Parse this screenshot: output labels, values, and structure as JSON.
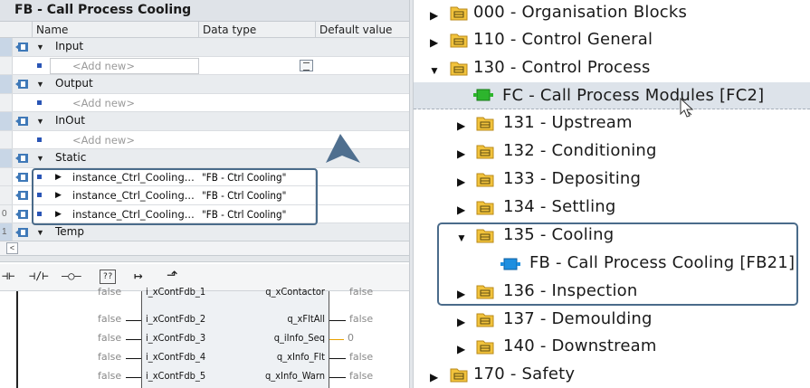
{
  "left": {
    "title": "FB - Call Process Cooling",
    "columns": {
      "name": "Name",
      "datatype": "Data type",
      "default": "Default value"
    },
    "rows": [
      {
        "kind": "section",
        "label": "Input"
      },
      {
        "kind": "addnew",
        "label": "<Add new>"
      },
      {
        "kind": "section",
        "label": "Output"
      },
      {
        "kind": "addnew",
        "label": "<Add new>"
      },
      {
        "kind": "section",
        "label": "InOut"
      },
      {
        "kind": "addnew",
        "label": "<Add new>"
      },
      {
        "kind": "section",
        "label": "Static"
      },
      {
        "kind": "instance",
        "label": "instance_Ctrl_Cooling...",
        "datatype": "\"FB - Ctrl Cooling\""
      },
      {
        "kind": "instance",
        "label": "instance_Ctrl_Cooling...",
        "datatype": "\"FB - Ctrl Cooling\""
      },
      {
        "kind": "instance",
        "label": "instance_Ctrl_Cooling...",
        "datatype": "\"FB - Ctrl Cooling\"",
        "gutter": "0"
      },
      {
        "kind": "section",
        "label": "Temp",
        "gutter": "1"
      }
    ],
    "scroll_left": "<",
    "toolbar": [
      "⊣⊢",
      "⊣/⊢",
      "–○–",
      "??",
      "↦",
      "⬏"
    ],
    "ladder": {
      "top_partial": {
        "in_val": "false",
        "in_pin": "i_xContFdb_1",
        "out_pin": "q_xContactor",
        "out_val": "false"
      },
      "pins": [
        {
          "in_val": "false",
          "in_pin": "i_xContFdb_2",
          "out_pin": "q_xFltAll",
          "out_val": "false"
        },
        {
          "in_val": "false",
          "in_pin": "i_xContFdb_3",
          "out_pin": "q_iInfo_Seq",
          "out_val": "0"
        },
        {
          "in_val": "false",
          "in_pin": "i_xContFdb_4",
          "out_pin": "q_xInfo_Flt",
          "out_val": "false"
        },
        {
          "in_val": "false",
          "in_pin": "i_xContFdb_5",
          "out_pin": "q_xInfo_Warn",
          "out_val": "false"
        }
      ]
    }
  },
  "right": {
    "tree": [
      {
        "label": "000 - Organisation Blocks",
        "expanded": false,
        "type": "folder",
        "level": 0
      },
      {
        "label": "110 - Control General",
        "expanded": false,
        "type": "folder",
        "level": 0
      },
      {
        "label": "130 - Control Process",
        "expanded": true,
        "type": "folder",
        "level": 0
      },
      {
        "label": "FC - Call Process Modules [FC2]",
        "type": "fc",
        "level": 2
      },
      {
        "label": "131 - Upstream",
        "expanded": false,
        "type": "folder",
        "level": 1
      },
      {
        "label": "132 - Conditioning",
        "expanded": false,
        "type": "folder",
        "level": 1
      },
      {
        "label": "133 - Depositing",
        "expanded": false,
        "type": "folder",
        "level": 1
      },
      {
        "label": "134 - Settling",
        "expanded": false,
        "type": "folder",
        "level": 1
      },
      {
        "label": "135 - Cooling",
        "expanded": true,
        "type": "folder",
        "level": 1
      },
      {
        "label": "FB - Call Process Cooling [FB21]",
        "type": "fb",
        "level": 2
      },
      {
        "label": "136 - Inspection",
        "expanded": false,
        "type": "folder",
        "level": 1
      },
      {
        "label": "137 - Demoulding",
        "expanded": false,
        "type": "folder",
        "level": 1
      },
      {
        "label": "140 - Downstream",
        "expanded": false,
        "type": "folder",
        "level": 1
      },
      {
        "label": "170 - Safety",
        "expanded": false,
        "type": "folder",
        "level": 0
      }
    ]
  },
  "colors": {
    "accent_frame": "#4a6b8a",
    "fc_green": "#2db52d",
    "fb_blue": "#1e8fe0",
    "folder_yellow": "#f2c33c",
    "selection_bg": "#dde3ea"
  }
}
